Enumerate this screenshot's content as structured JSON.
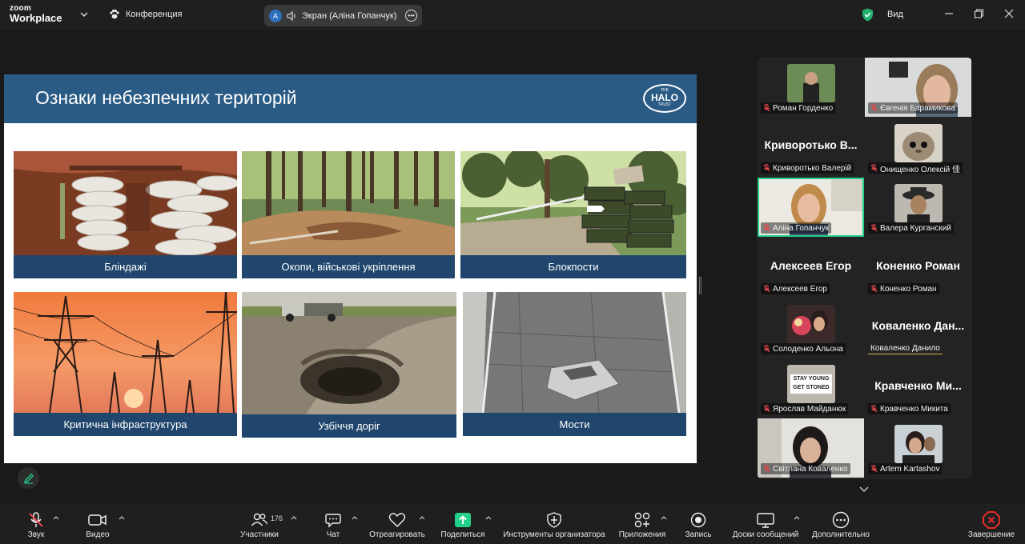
{
  "titlebar": {
    "brand_top": "zoom",
    "brand_bottom": "Workplace",
    "conference_label": "Конференция",
    "screen_share_avatar": "A",
    "screen_share_label": "Экран (Аліна Гопанчук)",
    "view_label": "Вид"
  },
  "slide": {
    "title": "Ознаки небезпечних територій",
    "logo": {
      "the": "THE",
      "halo": "HALO",
      "trust": "TRUST"
    },
    "tiles": [
      {
        "caption": "Бліндажі"
      },
      {
        "caption": "Окопи, військові укріплення"
      },
      {
        "caption": "Блокпости"
      },
      {
        "caption": "Критична інфраструктура"
      },
      {
        "caption": "Узбіччя доріг"
      },
      {
        "caption": "Мости"
      }
    ],
    "bridge_sign": [
      "STAY YOUNG",
      "GET STONED"
    ]
  },
  "participants": [
    {
      "name": "Роман Горденко"
    },
    {
      "name": "Євгенія Барамикова"
    },
    {
      "name": "Криворотько Валерій",
      "initials_text": "Криворотько В..."
    },
    {
      "name": "Онищенко Олексій 佳"
    },
    {
      "name": "Аліна Гопанчук"
    },
    {
      "name": "Валера Курганский"
    },
    {
      "name": "Алексеев Егор",
      "initials_text": "Алексеев Егор"
    },
    {
      "name": "Коненко Роман",
      "initials_text": "Коненко Роман"
    },
    {
      "name": "Солоденко Альона"
    },
    {
      "name": "Коваленко Данило",
      "initials_text": "Коваленко Дан..."
    },
    {
      "name": "Ярослав Майданюк",
      "sign_line1": "STAY YOUNG",
      "sign_line2": "GET STONED"
    },
    {
      "name": "Кравченко Микита",
      "initials_text": "Кравченко Ми..."
    },
    {
      "name": "Світлана Коваленко"
    },
    {
      "name": "Artem Kartashov"
    }
  ],
  "toolbar": {
    "sound": "Звук",
    "video": "Видео",
    "participants": "Участники",
    "participants_count": "176",
    "chat": "Чат",
    "react": "Отреагировать",
    "share": "Поделиться",
    "host_tools": "Инструменты организатора",
    "apps": "Приложения",
    "record": "Запись",
    "boards": "Доски сообщений",
    "more": "Дополнительно",
    "end": "Завершение"
  },
  "colors": {
    "slide_header": "#2a5b84",
    "caption_bar": "#20466d",
    "active_speaker": "#23d18b",
    "share_green": "#23d18b",
    "end_red": "#e02b2b",
    "mic_muted": "#e5484d"
  }
}
